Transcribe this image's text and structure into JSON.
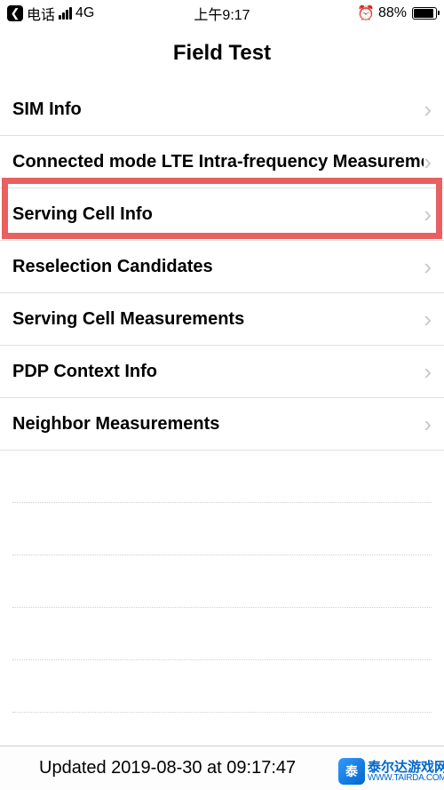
{
  "statusBar": {
    "backApp": "电话",
    "network": "4G",
    "time": "上午9:17",
    "battery": "88%"
  },
  "header": {
    "title": "Field Test"
  },
  "rows": [
    {
      "label": "SIM Info"
    },
    {
      "label": "Connected mode LTE Intra-frequency Measurement"
    },
    {
      "label": "Serving Cell Info"
    },
    {
      "label": "Reselection Candidates"
    },
    {
      "label": "Serving Cell Measurements"
    },
    {
      "label": "PDP Context Info"
    },
    {
      "label": "Neighbor Measurements"
    }
  ],
  "footer": {
    "updatedText": "Updated 2019-08-30 at 09:17:47"
  },
  "watermark": {
    "cn": "泰尔达游戏网",
    "url": "WWW.TAIRDA.COM"
  },
  "icons": {
    "alarm": "⏰"
  }
}
